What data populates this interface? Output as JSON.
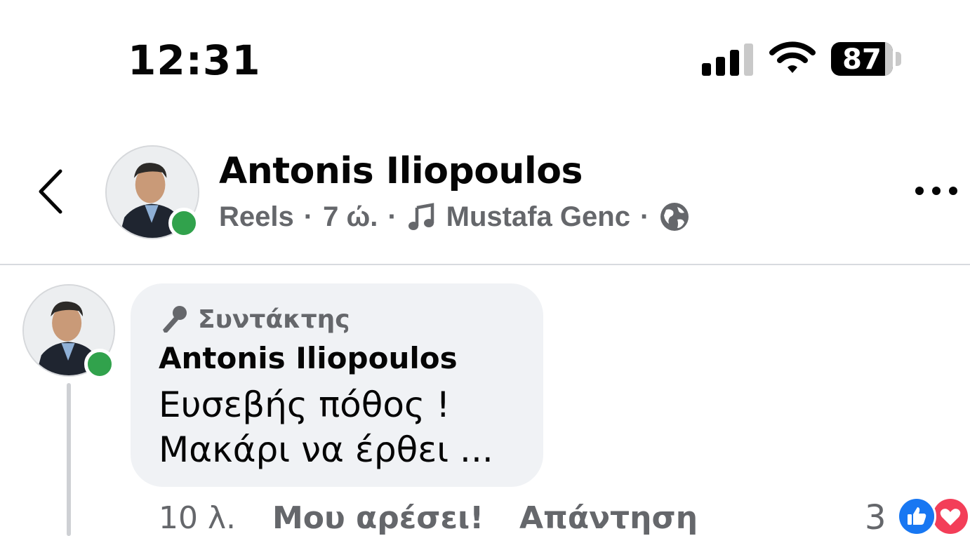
{
  "status_bar": {
    "time": "12:31",
    "battery_level": "87",
    "icons": [
      "cellular-signal-icon",
      "wifi-icon",
      "battery-icon"
    ]
  },
  "header": {
    "name": "Antonis Iliopoulos",
    "meta": {
      "type": "Reels",
      "time": "7 ώ.",
      "music": "Mustafa Genc"
    },
    "icons": [
      "back-chevron-icon",
      "music-note-icon",
      "globe-icon",
      "more-options-icon"
    ]
  },
  "comment": {
    "badge": "Συντάκτης",
    "author": "Antonis Iliopoulos",
    "text_line1": "Ευσεβής πόθος !",
    "text_line2": "Μακάρι να έρθει ...",
    "time": "10 λ.",
    "like_label": "Μου αρέσει!",
    "reply_label": "Απάντηση",
    "reaction_count": "3",
    "reactions": [
      "like-reaction-icon",
      "love-reaction-icon"
    ]
  },
  "colors": {
    "secondary_text": "#65676b",
    "bubble": "#f0f2f5",
    "online": "#31a24c",
    "like_blue": "#1877f2",
    "love_red": "#f33e58"
  }
}
